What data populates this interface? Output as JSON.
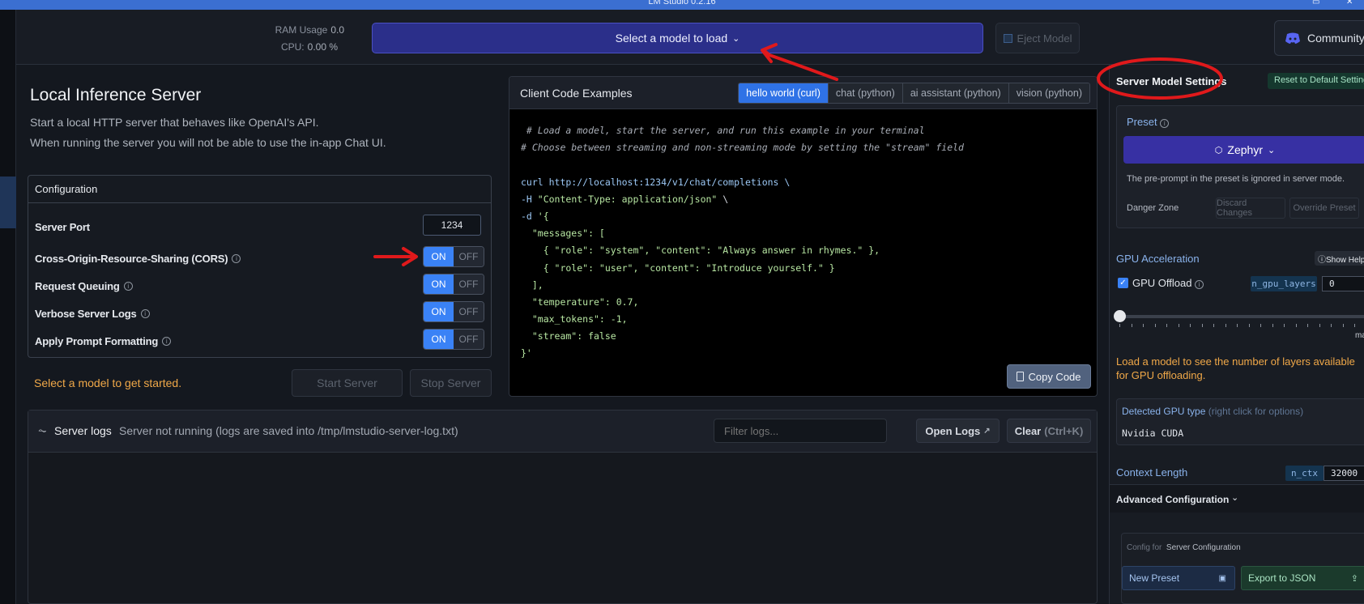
{
  "window": {
    "title": "LM Studio 0.2.16"
  },
  "topbar": {
    "ram_label": "RAM Usage",
    "ram_value": "0.0",
    "cpu_label": "CPU:",
    "cpu_value": "0.00 %",
    "select_model_label": "Select a model to load",
    "eject_label": "Eject Model",
    "community_label": "Community"
  },
  "server": {
    "title": "Local Inference Server",
    "desc_line1": "Start a local HTTP server that behaves like OpenAI's API.",
    "desc_line2": "When running the server you will not be able to use the in-app Chat UI.",
    "config": {
      "header": "Configuration",
      "port_label": "Server Port",
      "port_value": "1234",
      "on_label": "ON",
      "off_label": "OFF",
      "options": [
        {
          "label": "Cross-Origin-Resource-Sharing (CORS)",
          "state": "ON"
        },
        {
          "label": "Request Queuing",
          "state": "ON"
        },
        {
          "label": "Verbose Server Logs",
          "state": "ON"
        },
        {
          "label": "Apply Prompt Formatting",
          "state": "ON"
        }
      ]
    },
    "status_message": "Select a model to get started.",
    "start_label": "Start Server",
    "stop_label": "Stop Server"
  },
  "code": {
    "title": "Client Code Examples",
    "tabs": [
      "hello world (curl)",
      "chat (python)",
      "ai assistant (python)",
      "vision (python)"
    ],
    "active_tab": 0,
    "copy_label": "Copy Code",
    "lines": [
      {
        "cls": "cm",
        "text": " # Load a model, start the server, and run this example in your terminal"
      },
      {
        "cls": "cm",
        "text": "# Choose between streaming and non-streaming mode by setting the \"stream\" field"
      },
      {
        "cls": "sym",
        "text": ""
      },
      {
        "cls": "kw",
        "text": "curl http://localhost:1234/v1/chat/completions \\"
      },
      {
        "cls": "mix1",
        "text": "-H \"Content-Type: application/json\" \\"
      },
      {
        "cls": "mix2",
        "text": "-d '{"
      },
      {
        "cls": "str",
        "text": "  \"messages\": ["
      },
      {
        "cls": "str",
        "text": "    { \"role\": \"system\", \"content\": \"Always answer in rhymes.\" },"
      },
      {
        "cls": "str",
        "text": "    { \"role\": \"user\", \"content\": \"Introduce yourself.\" }"
      },
      {
        "cls": "str",
        "text": "  ],"
      },
      {
        "cls": "str",
        "text": "  \"temperature\": 0.7,"
      },
      {
        "cls": "str",
        "text": "  \"max_tokens\": -1,"
      },
      {
        "cls": "str",
        "text": "  \"stream\": false"
      },
      {
        "cls": "str",
        "text": "}'"
      }
    ]
  },
  "logs": {
    "title": "Server logs",
    "status": "Server not running (logs are saved into /tmp/lmstudio-server-log.txt)",
    "filter_placeholder": "Filter logs...",
    "open_label": "Open Logs",
    "clear_label": "Clear",
    "clear_shortcut": "(Ctrl+K)"
  },
  "settings": {
    "title": "Server Model Settings",
    "reset_label": "Reset to Default Settings",
    "preset_label": "Preset",
    "preset_value": "Zephyr",
    "preset_note": "The pre-prompt in the preset is ignored in server mode.",
    "danger_label": "Danger Zone",
    "discard_label": "Discard Changes",
    "override_label": "Override Preset",
    "gpu_title": "GPU Acceleration",
    "show_help_label": "Show Help",
    "gpu_offload_label": "GPU Offload",
    "n_gpu_layers": "n_gpu_layers",
    "gpu_layers_value": "0",
    "slider_max_label": "max",
    "gpu_note": "Load a model to see the number of layers available for GPU offloading.",
    "detected_label": "Detected GPU type",
    "detected_hint": "(right click for options)",
    "detected_value": "Nvidia CUDA",
    "context_label": "Context Length",
    "n_ctx": "n_ctx",
    "context_value": "32000",
    "advanced_label": "Advanced Configuration",
    "config_for_label": "Config for",
    "config_for_value": "Server Configuration",
    "new_preset_label": "New Preset",
    "export_label": "Export to JSON"
  },
  "colors": {
    "accent": "#3a82f6",
    "model_button": "#2b2f8a",
    "warning": "#f0a848",
    "annotation": "#e0191b"
  }
}
